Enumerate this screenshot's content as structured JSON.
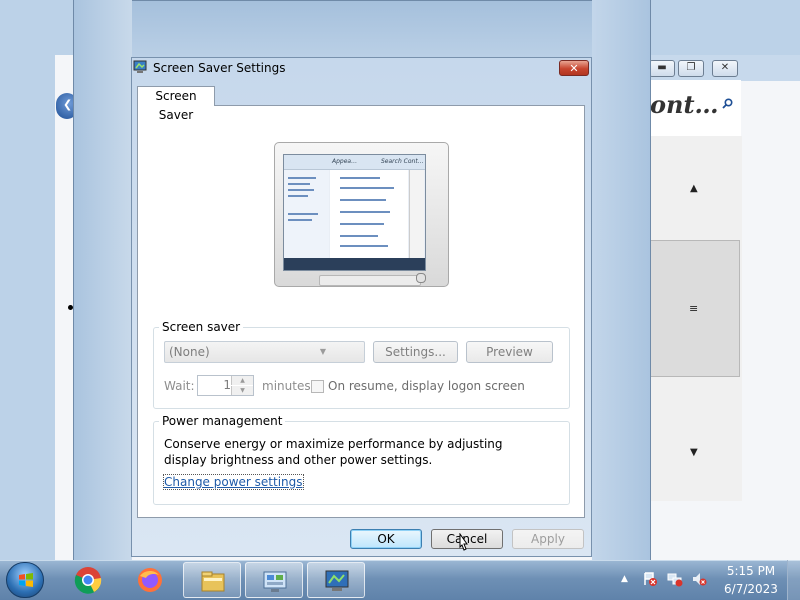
{
  "background_window": {
    "search_text": "ont…"
  },
  "dialog": {
    "title": "Screen Saver Settings",
    "close_label": "✕",
    "tab_label": "Screen Saver",
    "preview": {
      "header_text_1": "Appea…",
      "header_text_2": "Search Cont…"
    },
    "screen_saver": {
      "legend": "Screen saver",
      "selected": "(None)",
      "settings_label": "Settings...",
      "preview_label": "Preview",
      "wait_label": "Wait:",
      "wait_value": "1",
      "minutes_label": "minutes",
      "resume_label": "On resume, display logon screen"
    },
    "power": {
      "legend": "Power management",
      "description": "Conserve energy or maximize performance by adjusting display brightness and other power settings.",
      "link_label": "Change power settings"
    },
    "ok_label": "OK",
    "cancel_label": "Cancel",
    "apply_label": "Apply"
  },
  "taskbar": {
    "time": "5:15 PM",
    "date": "6/7/2023",
    "items": [
      "chrome-icon",
      "firefox-icon",
      "file-explorer-icon",
      "control-panel-icon",
      "screen-saver-icon"
    ]
  },
  "colors": {
    "link": "#1f5ba8",
    "close_button": "#c7452f",
    "taskbar": "#6e90b5"
  }
}
